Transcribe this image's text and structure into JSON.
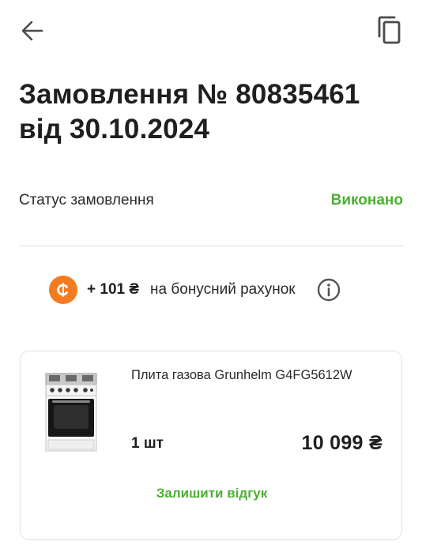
{
  "header": {
    "back_icon": "arrow-left-icon",
    "copy_icon": "copy-icon"
  },
  "order": {
    "title_line1": "Замовлення № 80835461",
    "title_line2": "від 30.10.2024"
  },
  "status": {
    "label": "Статус замовлення",
    "value": "Виконано",
    "value_color": "#4caf34"
  },
  "bonus": {
    "icon": "bonus-coin-icon",
    "icon_color": "#f47b20",
    "amount": "+ 101 ₴",
    "text": "на бонусний рахунок",
    "info_icon": "info-icon"
  },
  "product": {
    "image": "gas-stove-image",
    "name": "Плита газова Grunhelm G4FG5612W",
    "quantity": "1 шт",
    "price": "10 099 ₴",
    "review_label": "Залишити відгук"
  }
}
